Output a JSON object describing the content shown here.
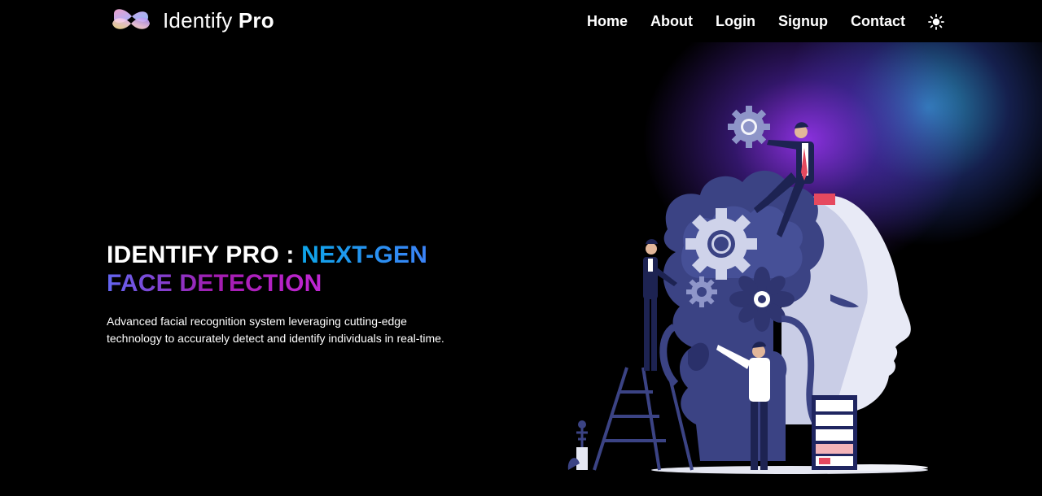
{
  "brand": {
    "name_light": "Identify",
    "name_bold": "Pro",
    "logo_icon": "infinity-logo-icon"
  },
  "nav": {
    "items": [
      {
        "label": "Home"
      },
      {
        "label": "About"
      },
      {
        "label": "Login"
      },
      {
        "label": "Signup"
      },
      {
        "label": "Contact"
      }
    ],
    "theme_toggle_icon": "sun-icon"
  },
  "hero": {
    "title_part1": "IDENTIFY PRO : ",
    "title_part2": "NEXT-GEN",
    "title_part3": "FACE DETECTION",
    "description": "Advanced facial recognition system leveraging cutting-edge technology to accurately detect and identify individuals in real-time."
  },
  "illustration": {
    "icon": "ai-head-gears-illustration"
  },
  "colors": {
    "background": "#000000",
    "accent_blue": "#0ea5e9",
    "accent_purple": "#9333ea",
    "illustration_navy": "#3b4384"
  }
}
